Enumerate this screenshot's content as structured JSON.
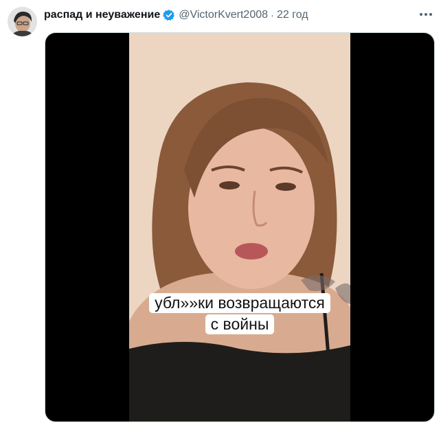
{
  "tweet": {
    "author_name": "распад и неуважение",
    "handle": "@VictorKvert2008",
    "separator": "·",
    "time": "22 год",
    "verified_icon": "verified-badge-icon",
    "more_icon": "more-options-icon"
  },
  "media": {
    "caption_line1": "убл»»ки возвращаются",
    "caption_line2": "с войны"
  },
  "colors": {
    "verified": "#1d9bf0",
    "text_primary": "#0f1419",
    "text_secondary": "#536471",
    "media_background": "#000000",
    "wall": "#e9d2bc"
  }
}
